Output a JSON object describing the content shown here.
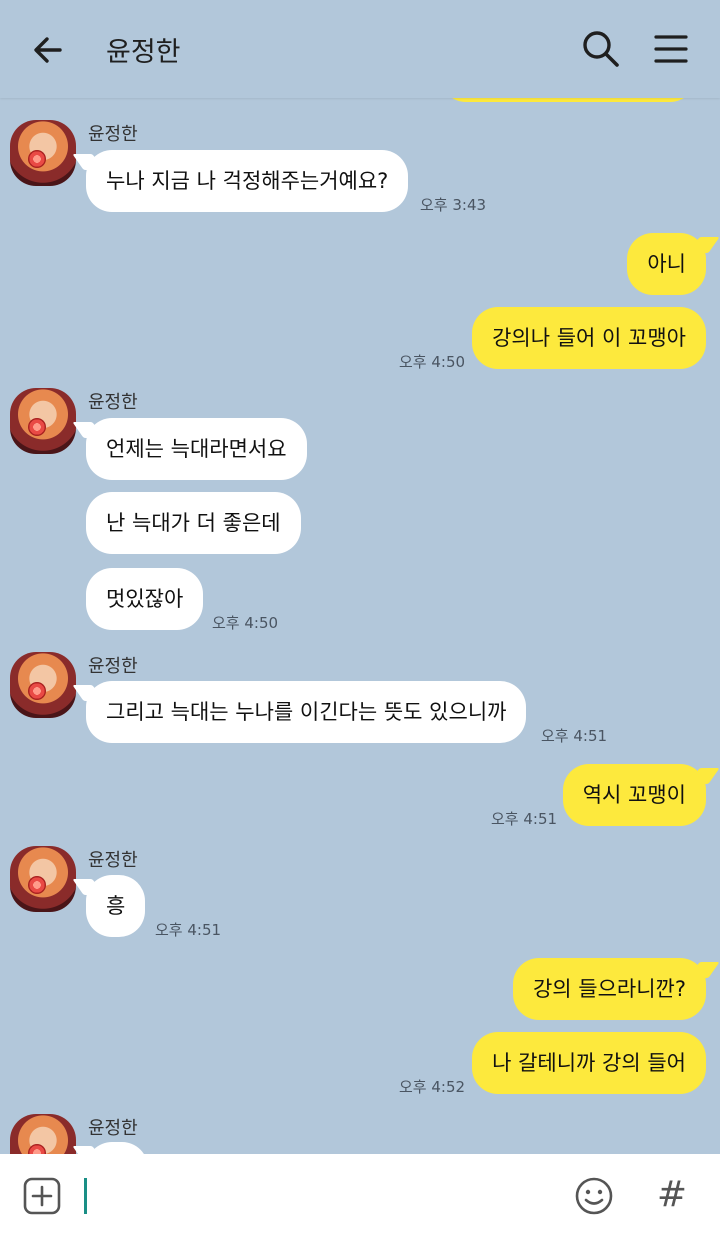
{
  "header": {
    "title": "윤정한"
  },
  "sender_name": "윤정한",
  "messages": {
    "m1": "누나 지금 나 걱정해주는거예요?",
    "t1": "오후 3:43",
    "m2": "아니",
    "m3": "강의나 들어 이 꼬맹아",
    "t2": "오후 4:50",
    "m4": "언제는 늑대라면서요",
    "m5": "난 늑대가 더 좋은데",
    "m6": "멋있잖아",
    "t3": "오후 4:50",
    "m7": "그리고 늑대는 누나를 이긴다는 뜻도 있으니까",
    "t4": "오후 4:51",
    "m8": "역시 꼬맹이",
    "t5": "오후 4:51",
    "m9": "흥",
    "t6": "오후 4:51",
    "m10": "강의 들으라니깐?",
    "m11": "나 갈테니까 강의 들어",
    "t7": "오후 4:52"
  },
  "footer": {
    "hash_label": "#"
  },
  "colors": {
    "background": "#b2c7da",
    "outgoing_bubble": "#fde93d",
    "incoming_bubble": "#ffffff",
    "cursor": "#1a8f86"
  },
  "icons": [
    "back-arrow-icon",
    "search-icon",
    "menu-icon",
    "plus-icon",
    "emoji-icon",
    "hash-icon"
  ]
}
